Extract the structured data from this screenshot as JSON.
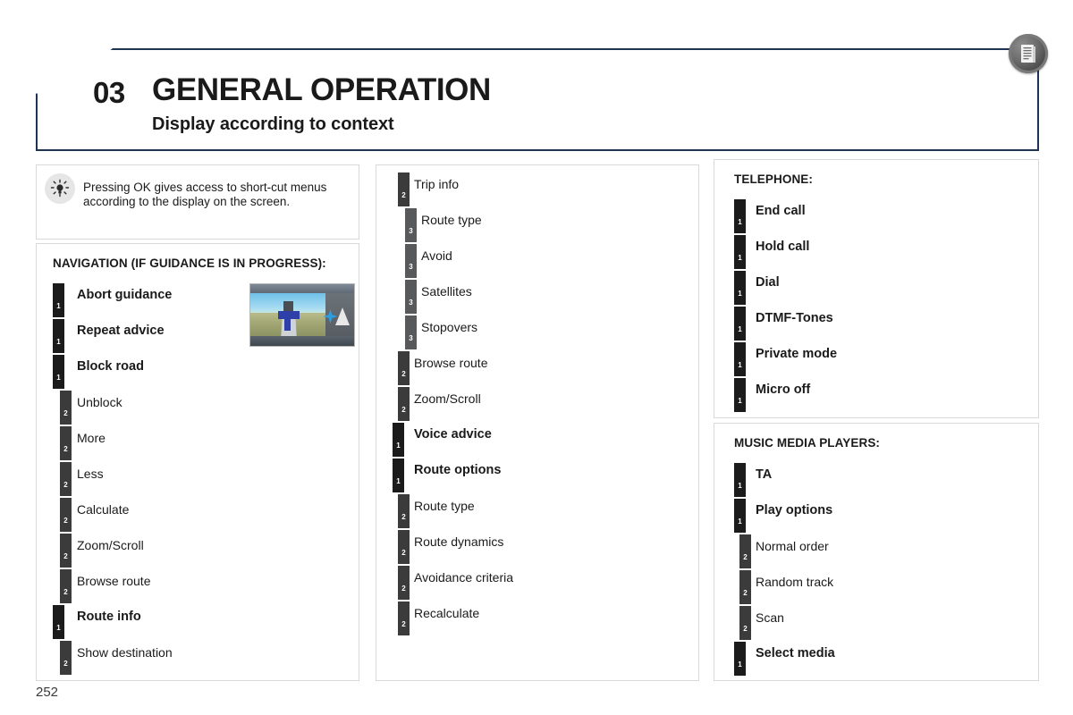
{
  "header": {
    "chapter_number": "03",
    "chapter_title": "GENERAL OPERATION",
    "subtitle": "Display according to context",
    "badge_icon": "document-list-icon",
    "border_color": "#1f3353"
  },
  "tip": {
    "icon": "lightbulb-icon",
    "text": "Pressing OK gives access to short-cut menus according to the display on the screen."
  },
  "navigation_panel": {
    "heading": "NAVIGATION (IF GUIDANCE IS IN PROGRESS):",
    "thumbnail_alt": "navigation-3d-view-thumbnail",
    "items": [
      {
        "level": "1",
        "label": "Abort guidance"
      },
      {
        "level": "1",
        "label": "Repeat advice"
      },
      {
        "level": "1",
        "label": "Block road"
      },
      {
        "level": "2",
        "label": "Unblock"
      },
      {
        "level": "2",
        "label": "More"
      },
      {
        "level": "2",
        "label": "Less"
      },
      {
        "level": "2",
        "label": "Calculate"
      },
      {
        "level": "2",
        "label": "Zoom/Scroll"
      },
      {
        "level": "2",
        "label": "Browse route"
      },
      {
        "level": "1",
        "label": "Route info"
      },
      {
        "level": "2",
        "label": "Show destination"
      }
    ]
  },
  "middle_panel": {
    "items": [
      {
        "level": "2",
        "label": "Trip info"
      },
      {
        "level": "3",
        "label": "Route type"
      },
      {
        "level": "3",
        "label": "Avoid"
      },
      {
        "level": "3",
        "label": "Satellites"
      },
      {
        "level": "3",
        "label": "Stopovers"
      },
      {
        "level": "2",
        "label": "Browse route"
      },
      {
        "level": "2",
        "label": "Zoom/Scroll"
      },
      {
        "level": "1",
        "label": "Voice advice"
      },
      {
        "level": "1",
        "label": "Route options"
      },
      {
        "level": "2",
        "label": "Route type"
      },
      {
        "level": "2",
        "label": "Route dynamics"
      },
      {
        "level": "2",
        "label": "Avoidance criteria"
      },
      {
        "level": "2",
        "label": "Recalculate"
      }
    ]
  },
  "telephone_panel": {
    "heading": "TELEPHONE:",
    "items": [
      {
        "level": "1",
        "label": "End call"
      },
      {
        "level": "1",
        "label": "Hold call"
      },
      {
        "level": "1",
        "label": "Dial"
      },
      {
        "level": "1",
        "label": "DTMF-Tones"
      },
      {
        "level": "1",
        "label": "Private mode"
      },
      {
        "level": "1",
        "label": "Micro off"
      }
    ]
  },
  "media_panel": {
    "heading": "MUSIC MEDIA PLAYERS:",
    "items": [
      {
        "level": "1",
        "label": "TA"
      },
      {
        "level": "1",
        "label": "Play options"
      },
      {
        "level": "2",
        "label": "Normal order"
      },
      {
        "level": "2",
        "label": "Random track"
      },
      {
        "level": "2",
        "label": "Scan"
      },
      {
        "level": "1",
        "label": "Select media"
      }
    ]
  },
  "footer": {
    "page_number": "252"
  },
  "colors": {
    "level1_marker": "#1b1b1b",
    "level2_marker": "#3b3b3b",
    "level3_marker": "#58595b",
    "panel_border": "#d9d9d9",
    "header_border": "#1f3353"
  }
}
